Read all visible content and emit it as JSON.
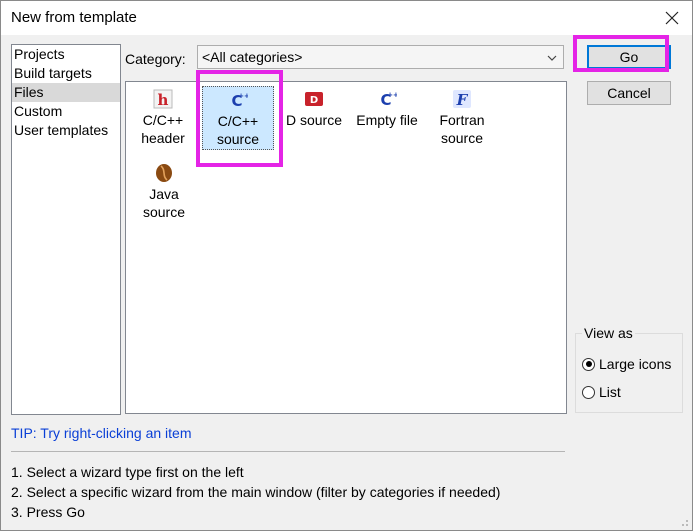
{
  "dialog": {
    "title": "New from template"
  },
  "left_list": {
    "items": [
      "Projects",
      "Build targets",
      "Files",
      "Custom",
      "User templates"
    ],
    "selected_index": 2
  },
  "category": {
    "label": "Category:",
    "value": "<All categories>"
  },
  "templates": [
    {
      "label": "C/C++\nheader",
      "icon": "c-header-icon",
      "selected": false
    },
    {
      "label": "C/C++\nsource",
      "icon": "cpp-source-icon",
      "selected": true
    },
    {
      "label": "D source",
      "icon": "d-source-icon",
      "selected": false
    },
    {
      "label": "Empty file",
      "icon": "empty-file-icon",
      "selected": false
    },
    {
      "label": "Fortran\nsource",
      "icon": "fortran-source-icon",
      "selected": false
    },
    {
      "label": "Java\nsource",
      "icon": "java-bean-icon",
      "selected": false
    }
  ],
  "buttons": {
    "go": "Go",
    "cancel": "Cancel"
  },
  "view_as": {
    "legend": "View as",
    "options": [
      "Large icons",
      "List"
    ],
    "selected": "Large icons"
  },
  "tip": "TIP: Try right-clicking an item",
  "instructions": [
    "1. Select a wizard type first on the left",
    "2. Select a specific wizard from the main window (filter by categories if needed)",
    "3. Press Go"
  ],
  "colors": {
    "highlight": "#e424e6",
    "selection": "#cce8ff",
    "tip_text": "#0a3fd6",
    "default_button_border": "#0078d7"
  }
}
